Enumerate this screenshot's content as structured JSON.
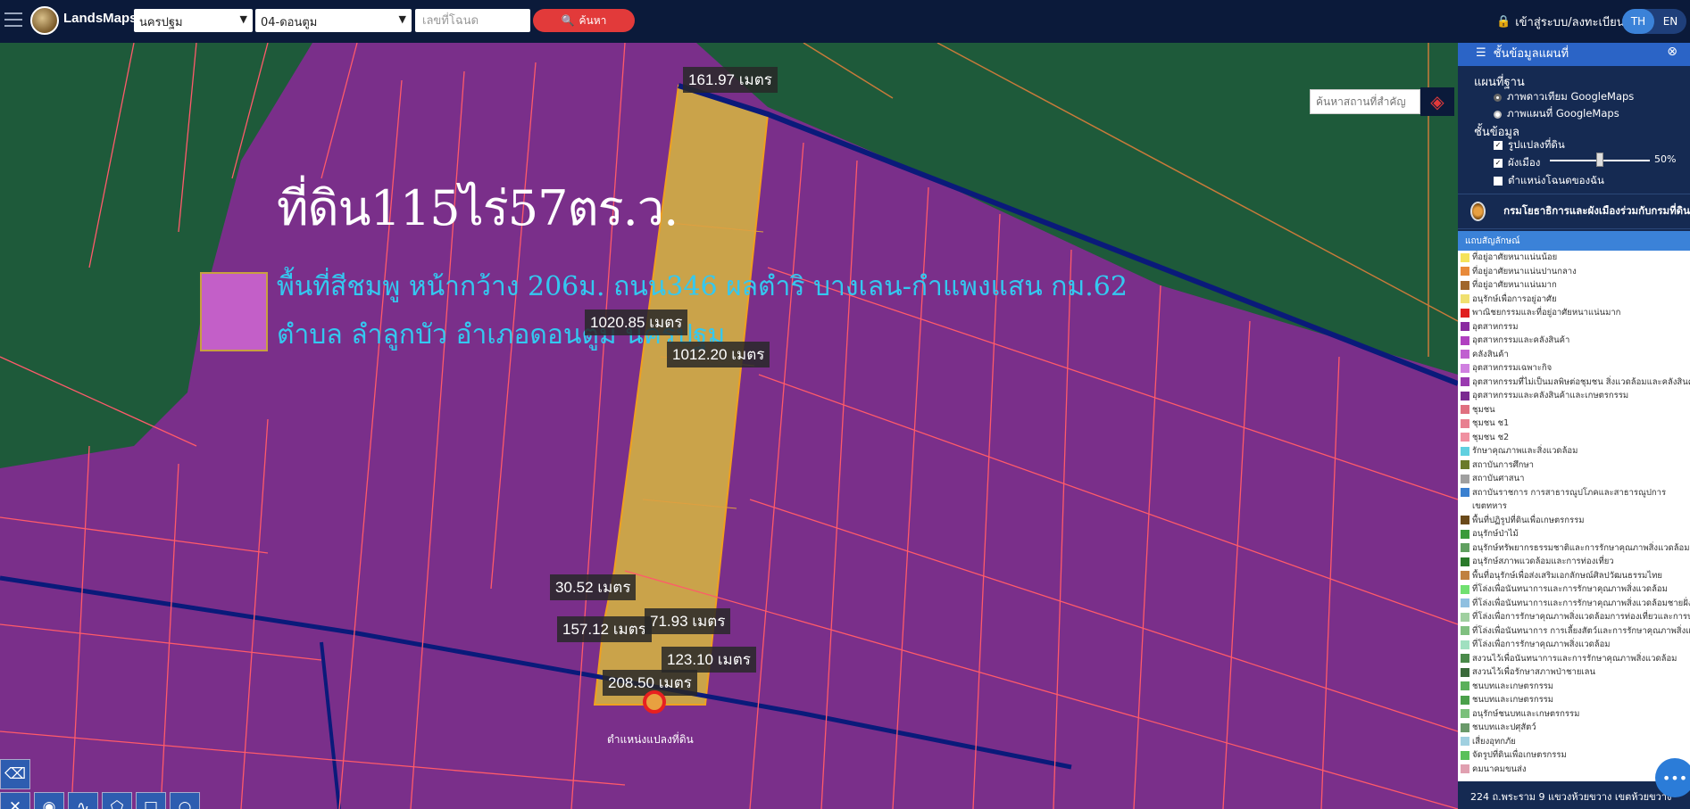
{
  "header": {
    "brand": "LandsMaps",
    "province": "นครปฐม",
    "district": "04-ดอนตูม",
    "deed_placeholder": "เลขที่โฉนด",
    "search_label": "ค้นหา",
    "login_label": "เข้าสู่ระบบ/ลงทะเบียน",
    "lang_th": "TH",
    "lang_en": "EN"
  },
  "map": {
    "place_search_placeholder": "ค้นหาสถานที่สำคัญ",
    "title": "ที่ดิน115ไร่57ตร.ว.",
    "subtitle_line1": "พื้นที่สีชมพู หน้ากว้าง 206ม. ถนน346 ผลตำริ บางเลน-กำแพงแสน กม.62",
    "subtitle_line2": "ตำบล ลำลูกบัว อำเภอดอนตูม นครปฐม",
    "point_label": "ตำแหน่งแปลงที่ดิน",
    "measurements": {
      "top": "161.97 เมตร",
      "left_long": "1020.85 เมตร",
      "right_long": "1012.20 เมตร",
      "m1": "30.52 เมตร",
      "m2": "157.12 เมตร",
      "m3": "71.93 เมตร",
      "m4": "123.10 เมตร",
      "m5": "208.50 เมตร"
    }
  },
  "panel": {
    "title": "ชั้นข้อมูลแผนที่",
    "basemap_heading": "แผนที่ฐาน",
    "basemaps": [
      "ภาพดาวเทียม GoogleMaps",
      "ภาพแผนที่ GoogleMaps"
    ],
    "layers_heading": "ชั้นข้อมูล",
    "layers": [
      "รูปแปลงที่ดิน",
      "ผังเมือง",
      "ตำแหน่งโฉนดของฉัน"
    ],
    "opacity": "50%",
    "agency": "กรมโยธาธิการและผังเมืองร่วมกับกรมที่ดิน",
    "legend_heading": "แถบสัญลักษณ์",
    "legend": [
      {
        "label": "ที่อยู่อาศัยหนาแน่นน้อย",
        "color": "#f5e35a"
      },
      {
        "label": "ที่อยู่อาศัยหนาแน่นปานกลาง",
        "color": "#e88a3a"
      },
      {
        "label": "ที่อยู่อาศัยหนาแน่นมาก",
        "color": "#a0662a"
      },
      {
        "label": "อนุรักษ์เพื่อการอยู่อาศัย",
        "color": "#f0e070"
      },
      {
        "label": "พาณิชยกรรมและที่อยู่อาศัยหนาแน่นมาก",
        "color": "#e02020"
      },
      {
        "label": "อุตสาหกรรม",
        "color": "#8a2aa0"
      },
      {
        "label": "อุตสาหกรรมและคลังสินค้า",
        "color": "#b040c0"
      },
      {
        "label": "คลังสินค้า",
        "color": "#c060d0"
      },
      {
        "label": "อุตสาหกรรมเฉพาะกิจ",
        "color": "#d080e0"
      },
      {
        "label": "อุตสาหกรรมที่ไม่เป็นมลพิษต่อชุมชน สิ่งแวดล้อมและคลังสินค้า",
        "color": "#9a3ab0"
      },
      {
        "label": "อุตสาหกรรมและคลังสินค้าและเกษตรกรรม",
        "color": "#7a2a90"
      },
      {
        "label": "ชุมชน",
        "color": "#e07080"
      },
      {
        "label": "ชุมชน ช1",
        "color": "#e88090"
      },
      {
        "label": "ชุมชน ช2",
        "color": "#f090a0"
      },
      {
        "label": "รักษาคุณภาพและสิ่งแวดล้อม",
        "color": "#60d0e0"
      },
      {
        "label": "สถาบันการศึกษา",
        "color": "#6a7a2a"
      },
      {
        "label": "สถาบันศาสนา",
        "color": "#a0a0a0"
      },
      {
        "label": "สถาบันราชการ การสาธารณูปโภคและสาธารณูปการ",
        "color": "#3a80d0"
      },
      {
        "label": "เขตทหาร",
        "color": "#ffffff"
      },
      {
        "label": "พื้นที่ปฏิรูปที่ดินเพื่อเกษตรกรรม",
        "color": "#6a4a1a"
      },
      {
        "label": "อนุรักษ์ป่าไม้",
        "color": "#3a9a3a"
      },
      {
        "label": "อนุรักษ์ทรัพยากรธรรมชาติและการรักษาคุณภาพสิ่งแวดล้อม",
        "color": "#60a060"
      },
      {
        "label": "อนุรักษ์สภาพแวดล้อมและการท่องเที่ยว",
        "color": "#2a7a2a"
      },
      {
        "label": "พื้นที่อนุรักษ์เพื่อส่งเสริมเอกลักษณ์ศิลปวัฒนธรรมไทย",
        "color": "#c08040"
      },
      {
        "label": "ที่โล่งเพื่อนันทนาการและการรักษาคุณภาพสิ่งแวดล้อม",
        "color": "#70e070"
      },
      {
        "label": "ที่โล่งเพื่อนันทนาการและการรักษาคุณภาพสิ่งแวดล้อมชายฝั่งทะเล",
        "color": "#90c0e0"
      },
      {
        "label": "ที่โล่งเพื่อการรักษาคุณภาพสิ่งแวดล้อมการท่องเที่ยวและการประมง",
        "color": "#a0d0a0"
      },
      {
        "label": "ที่โล่งเพื่อนันทนาการ การเลี้ยงสัตว์และการรักษาคุณภาพสิ่งแวดล้อม",
        "color": "#80c080"
      },
      {
        "label": "ที่โล่งเพื่อการรักษาคุณภาพสิ่งแวดล้อม",
        "color": "#a0e0c0"
      },
      {
        "label": "สงวนไว้เพื่อนันทนาการและการรักษาคุณภาพสิ่งแวดล้อม",
        "color": "#4a8a4a"
      },
      {
        "label": "สงวนไว้เพื่อรักษาสภาพป่าชายเลน",
        "color": "#3a6a3a"
      },
      {
        "label": "ชนบทและเกษตรกรรม",
        "color": "#5ab05a"
      },
      {
        "label": "ชนบทและเกษตรกรรม",
        "color": "#4aa04a"
      },
      {
        "label": "อนุรักษ์ชนบทและเกษตรกรรม",
        "color": "#7ac07a"
      },
      {
        "label": "ชนบทและปศุสัตว์",
        "color": "#6a9a6a"
      },
      {
        "label": "เสี่ยงอุทกภัย",
        "color": "#a0d0e0"
      },
      {
        "label": "จัดรูปที่ดินเพื่อเกษตรกรรม",
        "color": "#5ac05a"
      },
      {
        "label": "คมนาคมขนส่ง",
        "color": "#e0a0b0"
      }
    ],
    "footer_address": "224 ถ.พระราม 9 แขวงห้วยขวาง เขตห้วยขวาง"
  }
}
